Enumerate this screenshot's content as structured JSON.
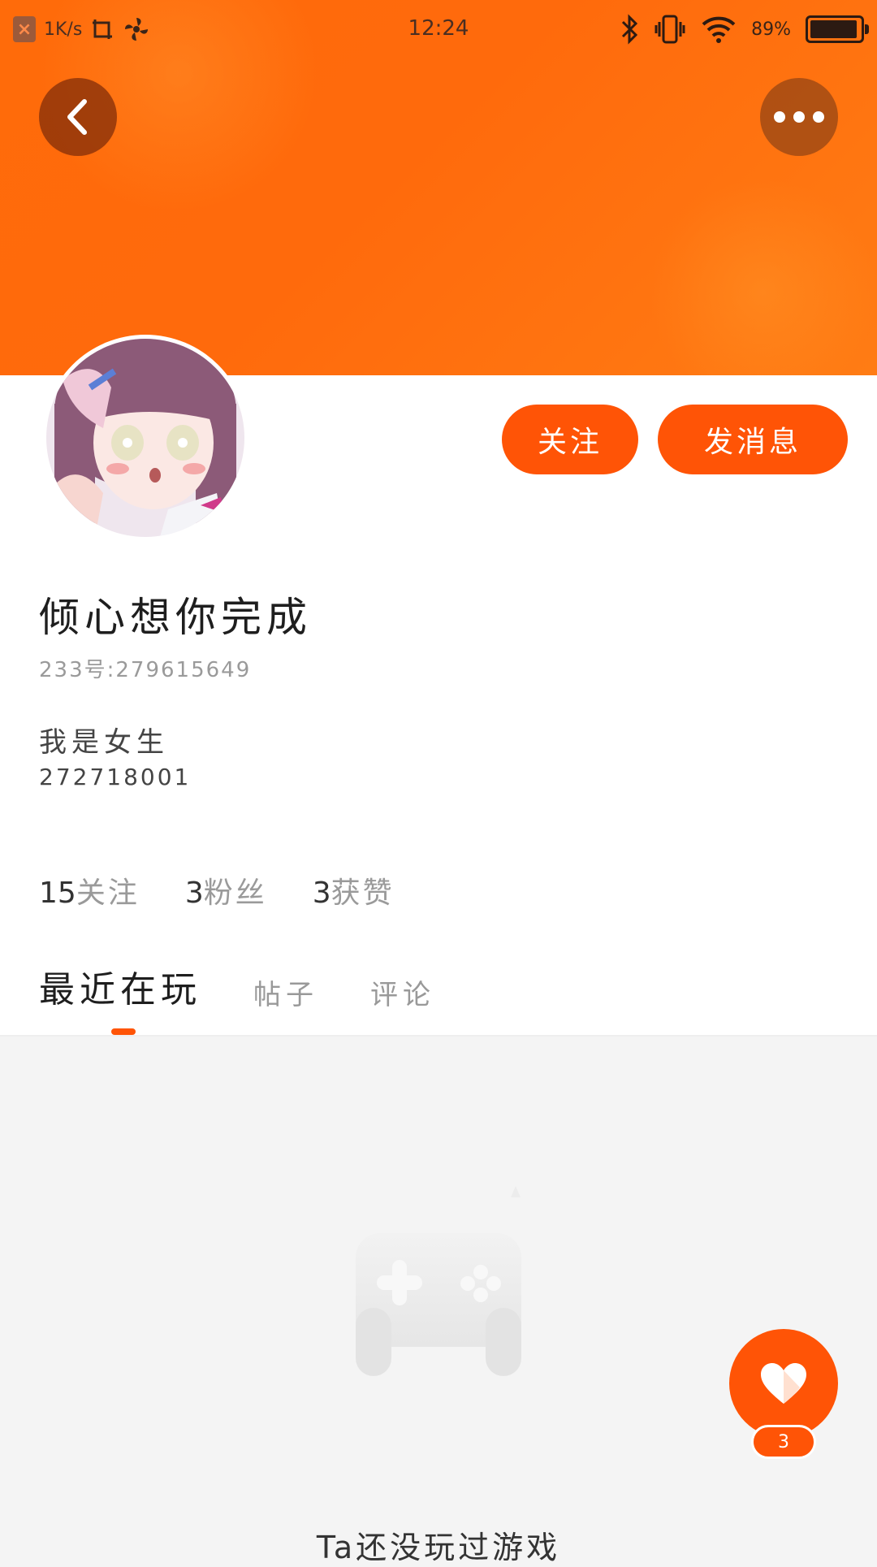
{
  "status_bar": {
    "speed": "1K/s",
    "time": "12:24",
    "battery": "89%"
  },
  "header": {
    "back_icon": "chevron-left-icon",
    "more_icon": "more-dots-icon"
  },
  "profile": {
    "name": "倾心想你完成",
    "id_label": "233号:279615649",
    "bio_line1": "我是女生",
    "bio_line2": "272718001",
    "follow_label": "关注",
    "message_label": "发消息"
  },
  "stats": [
    {
      "num": "15",
      "label": "关注"
    },
    {
      "num": "3",
      "label": "粉丝"
    },
    {
      "num": "3",
      "label": "获赞"
    }
  ],
  "tabs": [
    {
      "label": "最近在玩",
      "active": true
    },
    {
      "label": "帖子",
      "active": false
    },
    {
      "label": "评论",
      "active": false
    }
  ],
  "empty_state": {
    "icon": "gamepad-icon",
    "text": "Ta还没玩过游戏"
  },
  "like_fab": {
    "icon": "heart-icon",
    "count": "3"
  },
  "colors": {
    "accent": "#ff5406",
    "banner": "#ff6b0a"
  }
}
